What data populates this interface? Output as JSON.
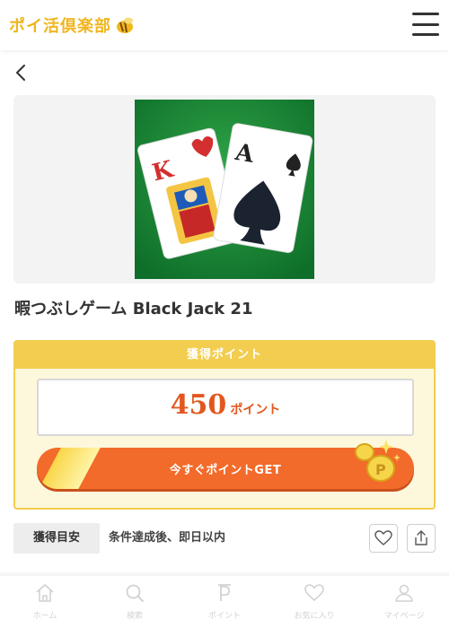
{
  "header": {
    "logo_text": "ポイ活倶楽部"
  },
  "game": {
    "title": "暇つぶしゲーム Black Jack 21"
  },
  "points": {
    "heading": "獲得ポイント",
    "value": "450",
    "unit": "ポイント",
    "get_button_label": "今すぐポイントGET"
  },
  "condition": {
    "tag_label": "獲得目安",
    "text": "条件達成後、即日以内"
  },
  "tabbar": {
    "items": [
      {
        "label": "ホーム",
        "icon": "home-icon"
      },
      {
        "label": "検索",
        "icon": "search-icon"
      },
      {
        "label": "ポイント",
        "icon": "point-icon"
      },
      {
        "label": "お気に入り",
        "icon": "heart-icon"
      },
      {
        "label": "マイページ",
        "icon": "user-icon"
      }
    ]
  },
  "colors": {
    "brand_yellow": "#f2cd4f",
    "accent_orange": "#f26b2a",
    "point_text": "#e2571f",
    "tab_inactive": "#d2d2d2"
  }
}
